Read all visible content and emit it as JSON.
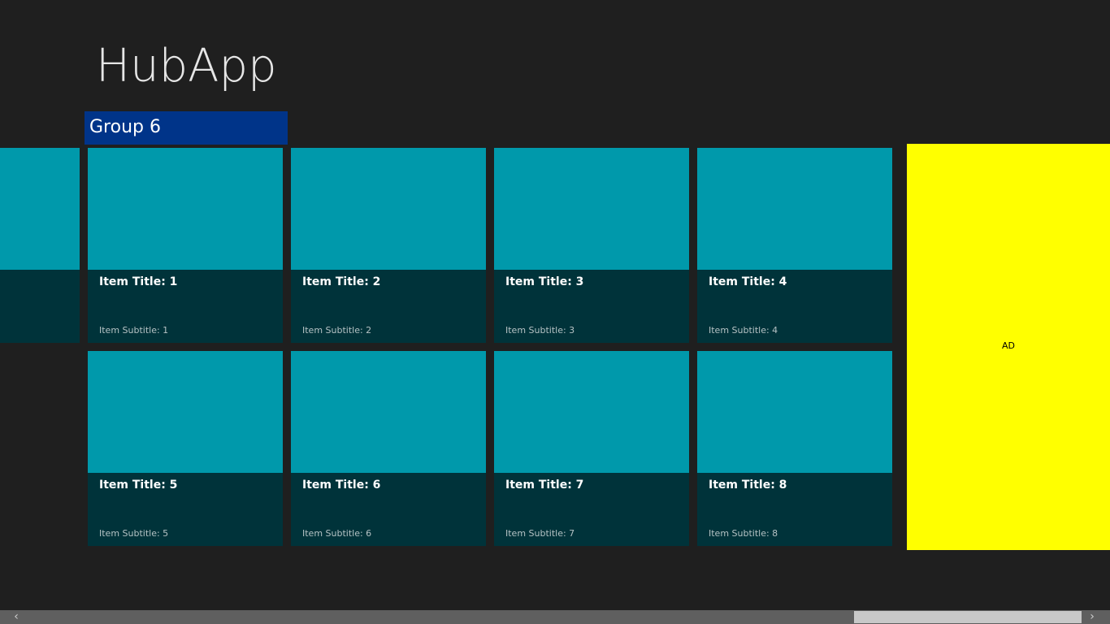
{
  "app": {
    "title": "HubApp"
  },
  "group": {
    "header": "Group 6"
  },
  "items": [
    {
      "title": "Item Title: 1",
      "subtitle": "Item Subtitle: 1"
    },
    {
      "title": "Item Title: 2",
      "subtitle": "Item Subtitle: 2"
    },
    {
      "title": "Item Title: 3",
      "subtitle": "Item Subtitle: 3"
    },
    {
      "title": "Item Title: 4",
      "subtitle": "Item Subtitle: 4"
    },
    {
      "title": "Item Title: 5",
      "subtitle": "Item Subtitle: 5"
    },
    {
      "title": "Item Title: 6",
      "subtitle": "Item Subtitle: 6"
    },
    {
      "title": "Item Title: 7",
      "subtitle": "Item Subtitle: 7"
    },
    {
      "title": "Item Title: 8",
      "subtitle": "Item Subtitle: 8"
    }
  ],
  "ad": {
    "label": "AD",
    "color": "#ffff00"
  },
  "colors": {
    "background": "#1f1f1f",
    "header_accent": "#003489",
    "tile_image": "#0099ab",
    "tile_overlay": "#00333a"
  },
  "scrollbar": {
    "left_icon": "chevron-left-icon",
    "right_icon": "chevron-right-icon",
    "left_glyph": "‹",
    "right_glyph": "›"
  }
}
